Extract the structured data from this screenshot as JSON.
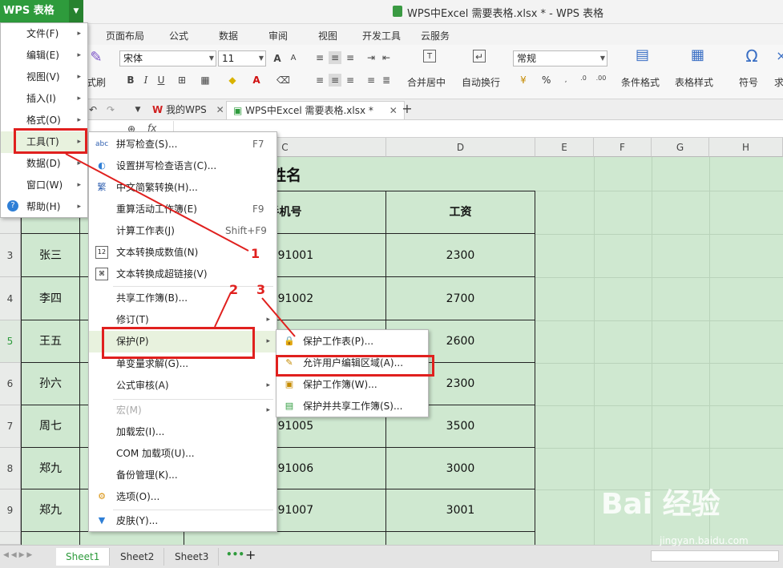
{
  "app": {
    "button_label": "WPS 表格",
    "window_title": "WPS中Excel 需要表格.xlsx * - WPS 表格"
  },
  "ribbon_tabs": [
    "页面布局",
    "公式",
    "数据",
    "审阅",
    "视图",
    "开发工具",
    "云服务"
  ],
  "ribbon": {
    "font_name": "宋体",
    "font_size": "11",
    "number_format": "常规",
    "format_painter_fragment": "式刷",
    "merge_center": "合并居中",
    "wrap_text": "自动换行",
    "percent": "%",
    "cond_format": "条件格式",
    "table_style": "表格样式",
    "symbol": "符号",
    "trailing": "求"
  },
  "doc_tabs": [
    {
      "label": "我的WPS"
    },
    {
      "label": "WPS中Excel 需要表格.xlsx *"
    }
  ],
  "formula_bar": {
    "fx": "fx"
  },
  "sheet": {
    "title": "员工姓名",
    "columns": [
      "C",
      "D",
      "E",
      "F",
      "G",
      "H"
    ],
    "header_phone": "手机号",
    "header_salary": "工资",
    "rows": [
      {
        "num": "3",
        "name": "张三",
        "phone": "17891001",
        "salary": "2300"
      },
      {
        "num": "4",
        "name": "李四",
        "phone": "17891002",
        "salary": "2700"
      },
      {
        "num": "5",
        "name": "王五",
        "phone": "",
        "salary": "2600"
      },
      {
        "num": "6",
        "name": "孙六",
        "phone": "",
        "salary": "2300"
      },
      {
        "num": "7",
        "name": "周七",
        "phone": "17891005",
        "salary": "3500"
      },
      {
        "num": "8",
        "name": "郑九",
        "phone": "17891006",
        "salary": "3000"
      },
      {
        "num": "9",
        "name": "郑九",
        "phone": "17891007",
        "salary": "3001"
      }
    ]
  },
  "sheet_tabs": [
    "Sheet1",
    "Sheet2",
    "Sheet3"
  ],
  "main_menu": [
    {
      "label": "文件(F)"
    },
    {
      "label": "编辑(E)"
    },
    {
      "label": "视图(V)"
    },
    {
      "label": "插入(I)"
    },
    {
      "label": "格式(O)"
    },
    {
      "label": "工具(T)"
    },
    {
      "label": "数据(D)"
    },
    {
      "label": "窗口(W)"
    },
    {
      "label": "帮助(H)"
    }
  ],
  "tools_menu": [
    {
      "label": "拼写检查(S)...",
      "shortcut": "F7"
    },
    {
      "label": "设置拼写检查语言(C)...",
      "shortcut": ""
    },
    {
      "label": "中文简繁转换(H)...",
      "shortcut": ""
    },
    {
      "label": "重算活动工作簿(E)",
      "shortcut": "F9"
    },
    {
      "label": "计算工作表(J)",
      "shortcut": "Shift+F9"
    },
    {
      "label": "文本转换成数值(N)",
      "shortcut": ""
    },
    {
      "label": "文本转换成超链接(V)",
      "shortcut": ""
    },
    {
      "label": "共享工作簿(B)...",
      "shortcut": ""
    },
    {
      "label": "修订(T)",
      "shortcut": ""
    },
    {
      "label": "保护(P)",
      "shortcut": ""
    },
    {
      "label": "单变量求解(G)...",
      "shortcut": ""
    },
    {
      "label": "公式审核(A)",
      "shortcut": ""
    },
    {
      "label": "宏(M)",
      "shortcut": ""
    },
    {
      "label": "加载宏(I)...",
      "shortcut": ""
    },
    {
      "label": "COM 加载项(U)...",
      "shortcut": ""
    },
    {
      "label": "备份管理(K)...",
      "shortcut": ""
    },
    {
      "label": "选项(O)...",
      "shortcut": ""
    },
    {
      "label": "皮肤(Y)...",
      "shortcut": ""
    }
  ],
  "protect_menu": [
    {
      "label": "保护工作表(P)..."
    },
    {
      "label": "允许用户编辑区域(A)..."
    },
    {
      "label": "保护工作簿(W)..."
    },
    {
      "label": "保护并共享工作簿(S)..."
    }
  ],
  "annotations": [
    "1",
    "2",
    "3"
  ],
  "watermark": {
    "text": "Bai 经验",
    "url": "jingyan.baidu.com"
  },
  "colors": {
    "accent_green": "#2e9b3c",
    "sheet_fill": "#cfe8d0",
    "annotation_red": "#e0201e"
  }
}
